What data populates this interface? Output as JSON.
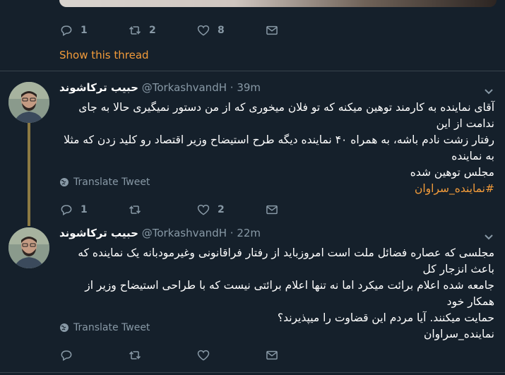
{
  "tweet0": {
    "reply_count": "1",
    "retweet_count": "2",
    "like_count": "8"
  },
  "show_thread_label": "Show this thread",
  "tweets": [
    {
      "display_name": "حبیب ترکاشوند",
      "handle": "@TorkashvandH",
      "time": "· 39m",
      "text_lines": [
        "آقای نماینده به کارمند توهین میکنه که تو فلان میخوری که از من دستور نمیگیری حالا به جای ندامت از این",
        "رفتار زشت نادم باشه، به همراه ۴۰ نماینده دیگه طرح استیضاح وزیر اقتصاد رو کلید زدن که مثلا به نماینده",
        "مجلس توهین شده"
      ],
      "hashtag": "#نماینده_سراوان",
      "translate_label": "Translate Tweet",
      "reply_count": "1",
      "retweet_count": "",
      "like_count": "2"
    },
    {
      "display_name": "حبیب ترکاشوند",
      "handle": "@TorkashvandH",
      "time": "· 22m",
      "text_lines": [
        "مجلسی که عصاره فضائل ملت است امروزباید از رفتار فراقانونی وغیرمودبانه یک نماینده که باعث انزجار کل",
        "جامعه شده اعلام برائت میکرد اما نه تنها اعلام برائتی نیست که با طراحی استیضاح وزیر از همکار خود",
        "حمایت میکنند. آیا مردم این قضاوت را میپذیرند؟",
        "نماینده_سراوان"
      ],
      "translate_label": "Translate Tweet",
      "reply_count": "",
      "retweet_count": "",
      "like_count": ""
    }
  ],
  "colors": {
    "background": "#15202b",
    "accent": "#f29b3a",
    "muted": "#8899a6",
    "divider": "#38444d",
    "thread_line": "#8c7a43"
  },
  "icons": [
    "reply-icon",
    "retweet-icon",
    "like-icon",
    "share-icon",
    "caret-down-icon",
    "globe-icon"
  ]
}
